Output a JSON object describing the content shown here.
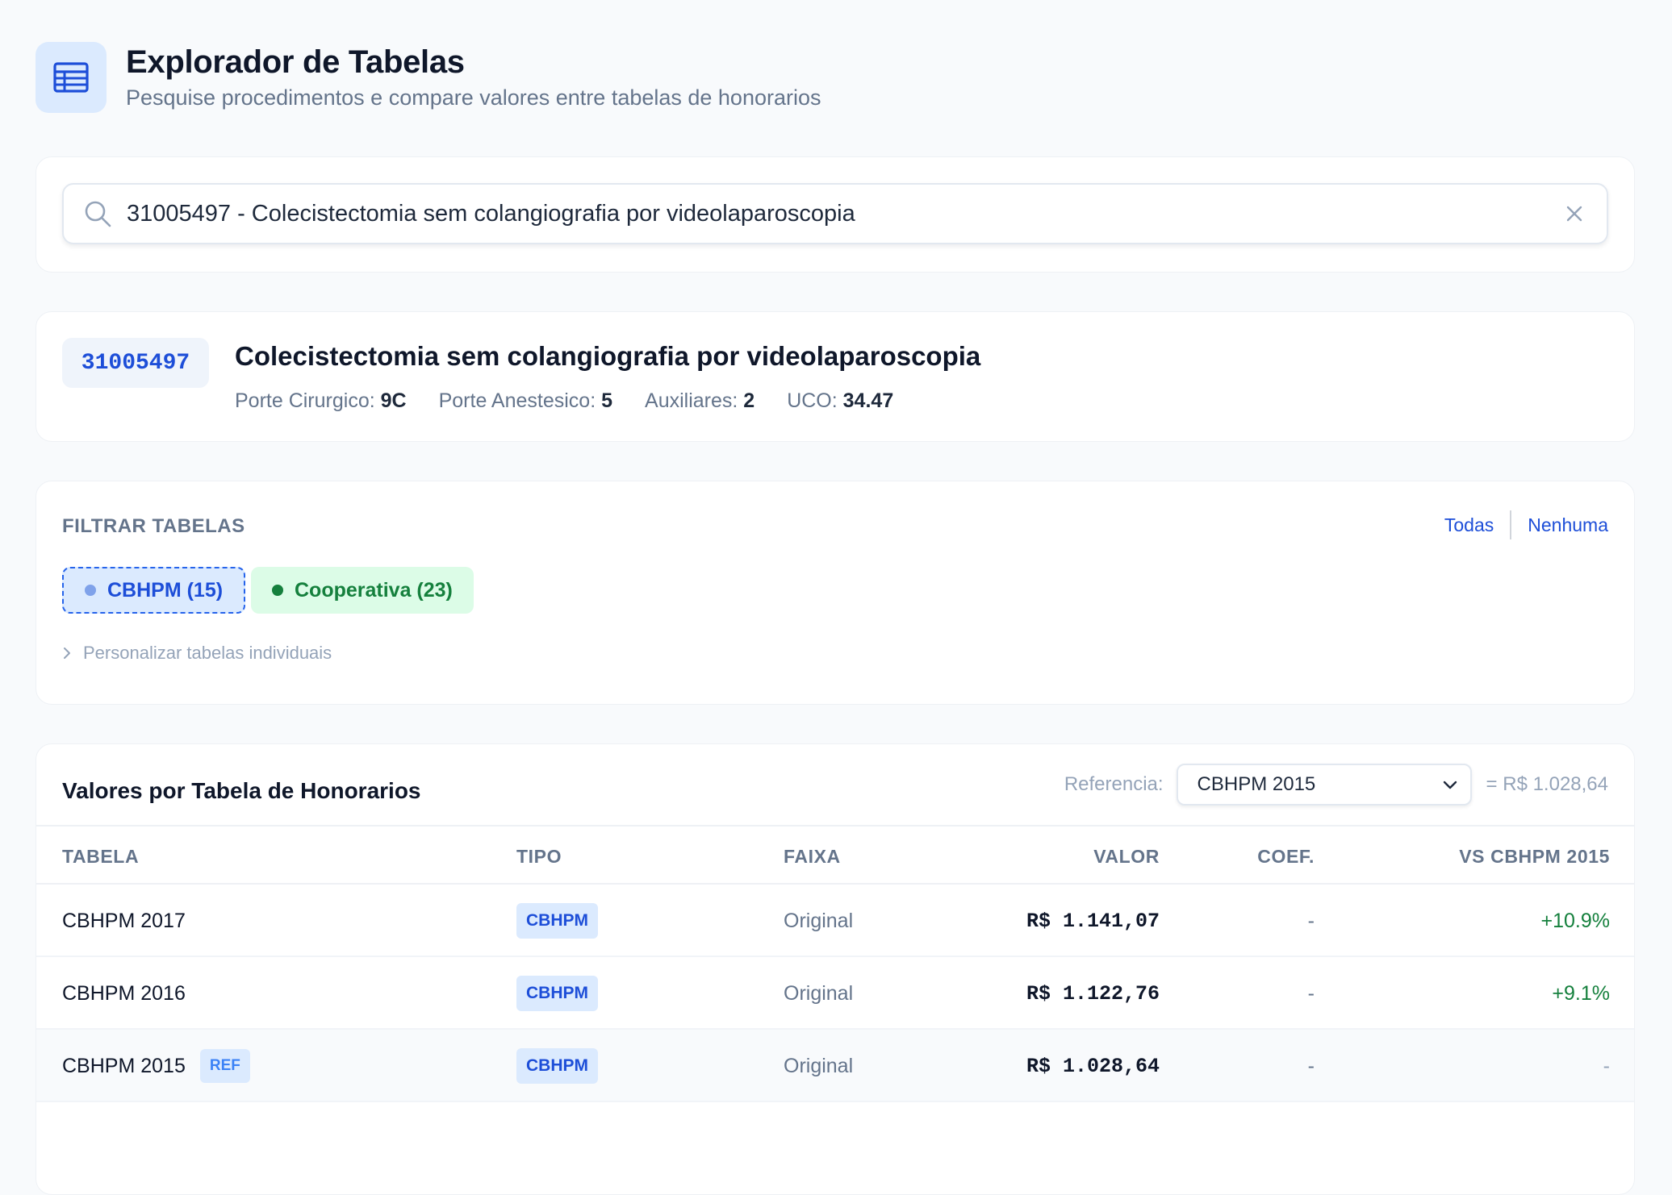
{
  "header": {
    "title": "Explorador de Tabelas",
    "subtitle": "Pesquise procedimentos e compare valores entre tabelas de honorarios",
    "icon": "table-icon"
  },
  "search": {
    "value": "31005497 - Colecistectomia sem colangiografia por videolaparoscopia",
    "icon": "search-icon",
    "clear_icon": "close-icon"
  },
  "procedure": {
    "code": "31005497",
    "name": "Colecistectomia sem colangiografia por videolaparoscopia",
    "porte_cirurgico_label": "Porte Cirurgico:",
    "porte_cirurgico": "9C",
    "porte_anestesico_label": "Porte Anestesico:",
    "porte_anestesico": "5",
    "auxiliares_label": "Auxiliares:",
    "auxiliares": "2",
    "uco_label": "UCO:",
    "uco": "34.47"
  },
  "filter": {
    "label": "FILTRAR TABELAS",
    "all_label": "Todas",
    "none_label": "Nenhuma",
    "chips": [
      {
        "label": "CBHPM (15)",
        "color": "#1d4ed8"
      },
      {
        "label": "Cooperativa (23)",
        "color": "#15803d"
      }
    ],
    "personalize_label": "Personalizar tabelas individuais"
  },
  "values_table": {
    "title": "Valores por Tabela de Honorarios",
    "reference_label": "Referencia:",
    "reference_selected": "CBHPM 2015",
    "reference_value": "= R$ 1.028,64",
    "columns": [
      "TABELA",
      "TIPO",
      "FAIXA",
      "VALOR",
      "COEF.",
      "VS CBHPM 2015"
    ],
    "rows": [
      {
        "tabela": "CBHPM 2017",
        "ref_badge": "",
        "tipo": "CBHPM",
        "faixa": "Original",
        "valor": "R$ 1.141,07",
        "coef": "-",
        "vs": "+10.9%"
      },
      {
        "tabela": "CBHPM 2016",
        "ref_badge": "",
        "tipo": "CBHPM",
        "faixa": "Original",
        "valor": "R$ 1.122,76",
        "coef": "-",
        "vs": "+9.1%"
      },
      {
        "tabela": "CBHPM 2015",
        "ref_badge": "REF",
        "tipo": "CBHPM",
        "faixa": "Original",
        "valor": "R$ 1.028,64",
        "coef": "-",
        "vs": "-"
      }
    ]
  },
  "colors": {
    "accent": "#1d4ed8",
    "positive": "#15803d",
    "muted": "#64748b"
  }
}
